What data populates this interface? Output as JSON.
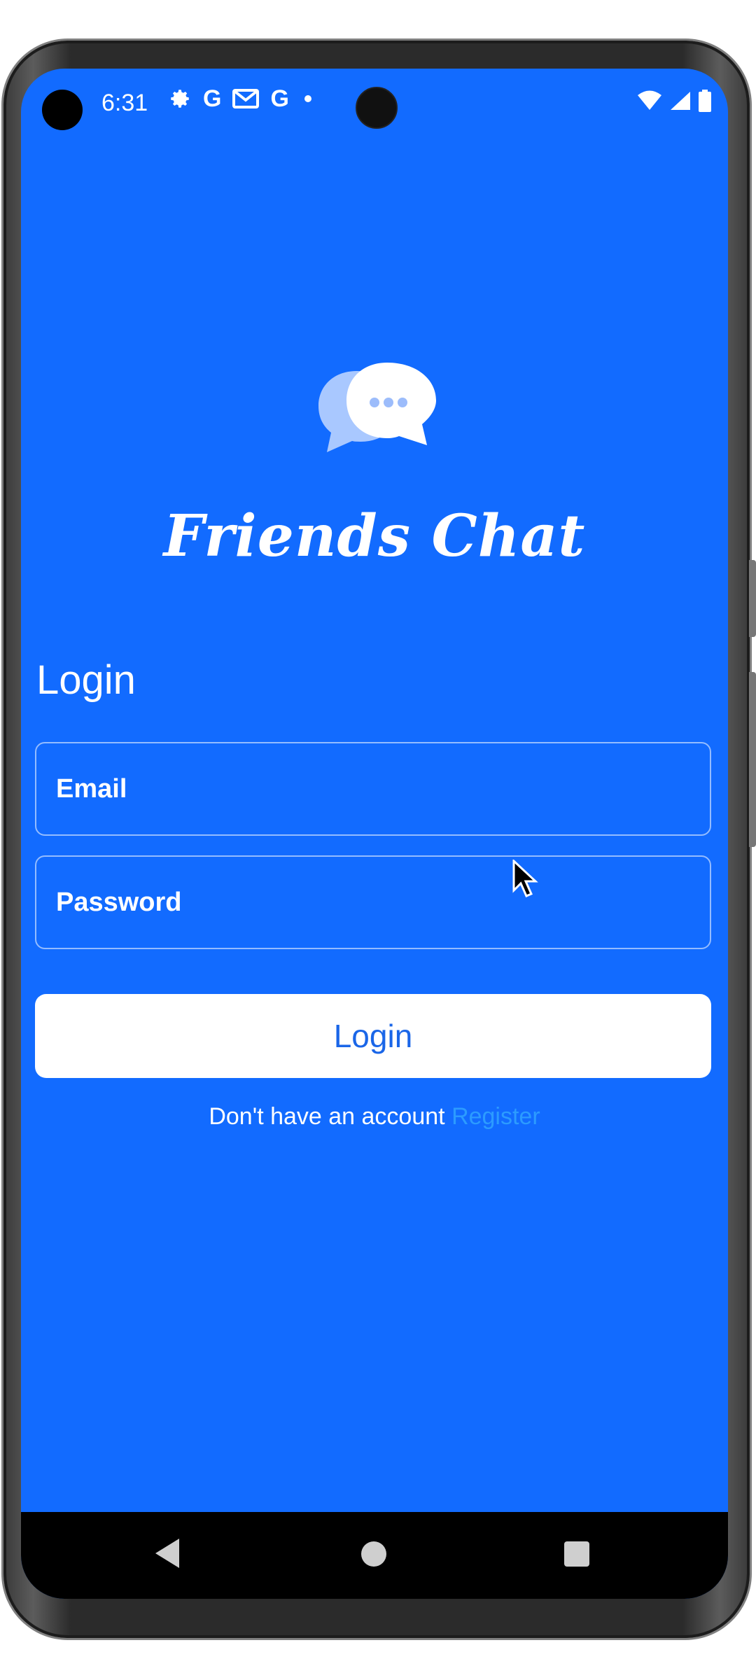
{
  "status_bar": {
    "time": "6:31",
    "left_icons": [
      "gear-icon",
      "google-icon",
      "gmail-icon",
      "google-icon",
      "dot-icon"
    ],
    "right_icons": [
      "wifi-icon",
      "signal-icon",
      "battery-icon"
    ]
  },
  "app": {
    "title": "Friends Chat",
    "logo": "chat-bubbles-icon",
    "brand_color": "#126bff"
  },
  "login": {
    "heading": "Login",
    "email_placeholder": "Email",
    "password_placeholder": "Password",
    "button_label": "Login",
    "no_account_text": "Don't have an account",
    "register_link": "Register",
    "register_link_color": "#2c9bff"
  },
  "nav_bar": {
    "buttons": [
      "back-icon",
      "home-icon",
      "recents-icon"
    ]
  }
}
